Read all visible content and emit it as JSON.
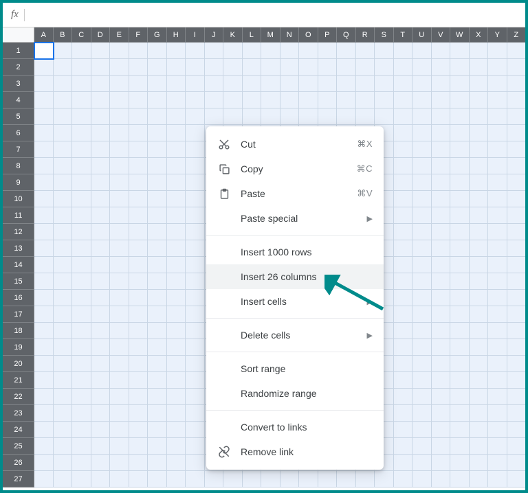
{
  "formula_bar": {
    "fx": "fx",
    "value": ""
  },
  "columns": [
    "A",
    "B",
    "C",
    "D",
    "E",
    "F",
    "G",
    "H",
    "I",
    "J",
    "K",
    "L",
    "M",
    "N",
    "O",
    "P",
    "Q",
    "R",
    "S",
    "T",
    "U",
    "V",
    "W",
    "X",
    "Y",
    "Z"
  ],
  "row_count": 27,
  "selected": {
    "row": 1,
    "col": "A"
  },
  "context_menu": {
    "cut": {
      "label": "Cut",
      "shortcut": "⌘X"
    },
    "copy": {
      "label": "Copy",
      "shortcut": "⌘C"
    },
    "paste": {
      "label": "Paste",
      "shortcut": "⌘V"
    },
    "paste_special": {
      "label": "Paste special"
    },
    "insert_rows": {
      "label": "Insert 1000 rows"
    },
    "insert_cols": {
      "label": "Insert 26 columns"
    },
    "insert_cells": {
      "label": "Insert cells"
    },
    "delete_cells": {
      "label": "Delete cells"
    },
    "sort_range": {
      "label": "Sort range"
    },
    "randomize": {
      "label": "Randomize range"
    },
    "convert_links": {
      "label": "Convert to links"
    },
    "remove_link": {
      "label": "Remove link"
    }
  },
  "colors": {
    "frame": "#008b8b",
    "accent": "#1a73e8",
    "pointer": "#008b8b"
  }
}
